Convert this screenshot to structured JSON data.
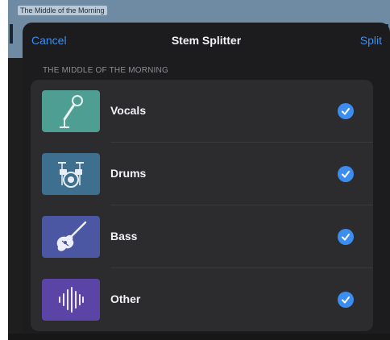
{
  "background": {
    "track_title": "The Middle of the Morning"
  },
  "nav": {
    "cancel_label": "Cancel",
    "title": "Stem Splitter",
    "split_label": "Split"
  },
  "section": {
    "header": "THE MIDDLE OF THE MORNING"
  },
  "stems": [
    {
      "label": "Vocals",
      "icon": "microphone-icon",
      "selected": true,
      "color": "#4f9e94"
    },
    {
      "label": "Drums",
      "icon": "drum-kit-icon",
      "selected": true,
      "color": "#3f6f8f"
    },
    {
      "label": "Bass",
      "icon": "bass-guitar-icon",
      "selected": true,
      "color": "#4b57a3"
    },
    {
      "label": "Other",
      "icon": "waveform-icon",
      "selected": true,
      "color": "#5a45a6"
    }
  ],
  "colors": {
    "accent": "#3b8ef0",
    "sheet_bg": "#1c1c1e",
    "list_bg": "#2c2c2e"
  }
}
